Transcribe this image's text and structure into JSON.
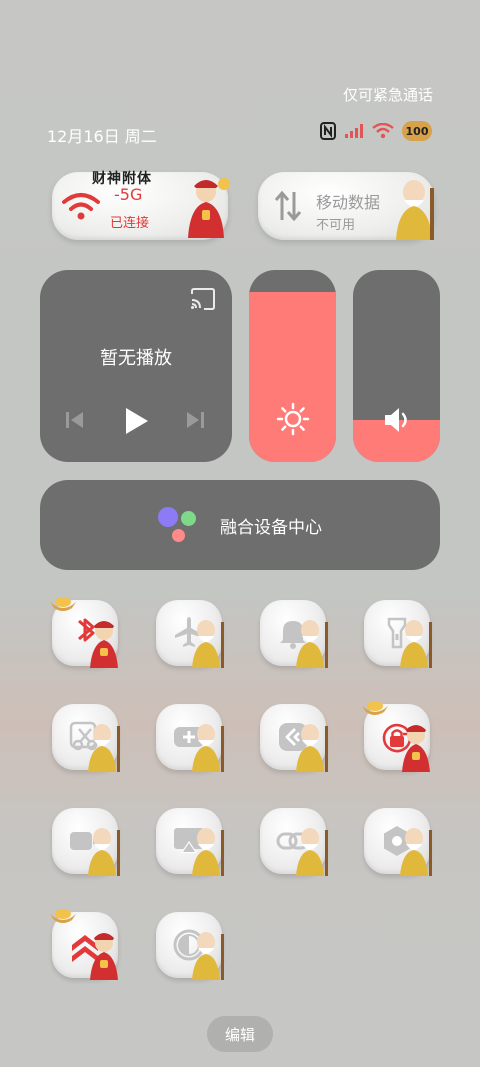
{
  "status_bar": {
    "emergency_text": "仅可紧急通话",
    "date_text": "12月16日 周二",
    "battery": "100",
    "icons": [
      "nfc-icon",
      "signal-icon",
      "wifi-icon",
      "battery-icon"
    ]
  },
  "tiles_top": {
    "wifi": {
      "banner": "财神附体",
      "title": "-5G",
      "status": "已连接",
      "icon": "wifi-icon",
      "active": true
    },
    "mobile_data": {
      "title": "移动数据",
      "status": "不可用",
      "icon": "data-arrows-icon",
      "active": false
    }
  },
  "media": {
    "title": "暂无播放",
    "icons": [
      "cast-icon",
      "previous-icon",
      "play-icon",
      "next-icon"
    ]
  },
  "sliders": {
    "brightness": {
      "level": 0.96,
      "icon": "sun-icon"
    },
    "volume": {
      "level": 0.2,
      "icon": "speaker-icon"
    }
  },
  "fusion": {
    "label": "融合设备中心",
    "icon": "device-center-icon"
  },
  "toggles": [
    {
      "name": "bluetooth",
      "icon": "bluetooth-icon",
      "active": true
    },
    {
      "name": "airplane-mode",
      "icon": "airplane-icon",
      "active": false
    },
    {
      "name": "mute",
      "icon": "bell-icon",
      "active": false
    },
    {
      "name": "flashlight",
      "icon": "flashlight-icon",
      "active": false
    },
    {
      "name": "screenshot",
      "icon": "scissors-icon",
      "active": false
    },
    {
      "name": "add-shortcut",
      "icon": "plus-card-icon",
      "active": false
    },
    {
      "name": "nearby-share",
      "icon": "share-link-icon",
      "active": false
    },
    {
      "name": "rotation-lock",
      "icon": "lock-rotate-icon",
      "active": true
    },
    {
      "name": "screen-record",
      "icon": "video-camera-icon",
      "active": false
    },
    {
      "name": "screen-cast",
      "icon": "cast-screen-icon",
      "active": false
    },
    {
      "name": "link",
      "icon": "chain-link-icon",
      "active": false
    },
    {
      "name": "settings",
      "icon": "hexagon-gear-icon",
      "active": false
    },
    {
      "name": "high-performance",
      "icon": "double-chevron-up-icon",
      "active": true
    },
    {
      "name": "dark-mode",
      "icon": "half-circle-icon",
      "active": false
    }
  ],
  "edit_label": "编辑",
  "colors": {
    "accent": "#e23a3a",
    "slider_fill": "#ff7b78",
    "panel": "#6e6e6e"
  }
}
